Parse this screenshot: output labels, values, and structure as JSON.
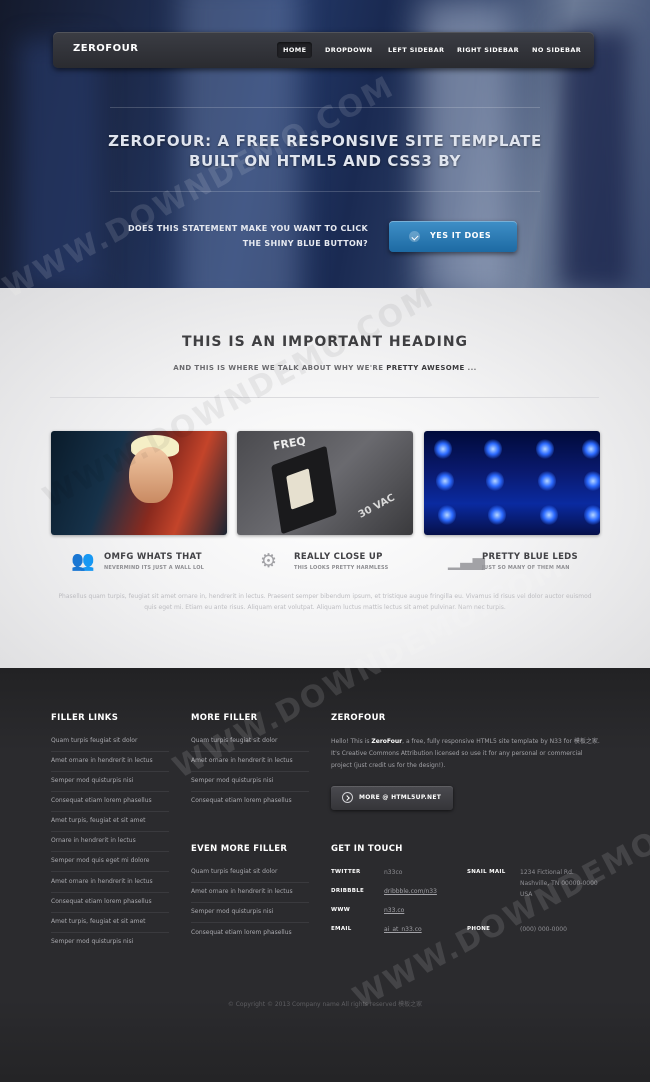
{
  "nav": {
    "logo": "ZEROFOUR",
    "items": [
      "HOME",
      "DROPDOWN",
      "LEFT SIDEBAR",
      "RIGHT SIDEBAR",
      "NO SIDEBAR"
    ]
  },
  "hero": {
    "title_line1": "ZEROFOUR: A FREE RESPONSIVE SITE TEMPLATE",
    "title_line2": "BUILT ON HTML5 AND CSS3 BY",
    "question_line1": "DOES THIS STATEMENT MAKE YOU WANT TO CLICK",
    "question_line2": "THE SHINY BLUE BUTTON?",
    "cta_label": "YES IT DOES"
  },
  "main": {
    "heading": "THIS IS AN IMPORTANT HEADING",
    "sub_prefix": "AND THIS IS WHERE WE TALK ABOUT WHY WE'RE",
    "sub_bold": "PRETTY AWESOME",
    "sub_suffix": "...",
    "thumb2_text1": "FREQ",
    "thumb2_text2": "30 VAC",
    "features": [
      {
        "icon": "users-icon",
        "title": "OMFG WHATS THAT",
        "subtitle": "NEVERMIND ITS JUST A WALL LOL"
      },
      {
        "icon": "gear-icon",
        "title": "REALLY CLOSE UP",
        "subtitle": "THIS LOOKS PRETTY HARMLESS"
      },
      {
        "icon": "bar-chart-icon",
        "title": "PRETTY BLUE LEDS",
        "subtitle": "JUST SO MANY OF THEM MAN"
      }
    ],
    "paragraph": "Phasellus quam turpis, feugiat sit amet ornare in, hendrerit in lectus. Praesent semper bibendum ipsum, et tristique augue fringilla eu. Vivamus id risus vel dolor auctor euismod quis eget mi. Etiam eu ante risus. Aliquam erat volutpat. Aliquam luctus mattis lectus sit amet pulvinar. Nam nec turpis."
  },
  "footer": {
    "filler_links": {
      "heading": "FILLER LINKS",
      "items": [
        "Quam turpis feugiat sit dolor",
        "Amet ornare in hendrerit in lectus",
        "Semper mod quisturpis nisi",
        "Consequat etiam lorem phasellus",
        "Amet turpis, feugiat et sit amet",
        "Ornare in hendrerit in lectus",
        "Semper mod quis eget mi dolore",
        "Amet ornare in hendrerit in lectus",
        "Consequat etiam lorem phasellus",
        "Amet turpis, feugiat et sit amet",
        "Semper mod quisturpis nisi"
      ]
    },
    "more_filler": {
      "heading": "MORE FILLER",
      "items": [
        "Quam turpis feugiat sit dolor",
        "Amet ornare in hendrerit in lectus",
        "Semper mod quisturpis nisi",
        "Consequat etiam lorem phasellus"
      ]
    },
    "even_more_filler": {
      "heading": "EVEN MORE FILLER",
      "items": [
        "Quam turpis feugiat sit dolor",
        "Amet ornare in hendrerit in lectus",
        "Semper mod quisturpis nisi",
        "Consequat etiam lorem phasellus"
      ]
    },
    "about": {
      "heading": "ZEROFOUR",
      "text_prefix": "Hello! This is",
      "text_bold": "ZeroFour",
      "text_rest": ", a free, fully responsive HTML5 site template by N33 for 模板之家. It's Creative Commons Attribution licensed so use it for any personal or commercial project (just credit us for the design!).",
      "button_label": "MORE @ HTML5UP.NET"
    },
    "contact": {
      "heading": "GET IN TOUCH",
      "twitter_label": "TWITTER",
      "twitter_value": "n33co",
      "dribbble_label": "DRIBBBLE",
      "dribbble_value": "dribbble.com/n33",
      "www_label": "WWW",
      "www_value": "n33.co",
      "email_label": "EMAIL",
      "email_value": "ai_at_n33.co",
      "snail_label": "SNAIL MAIL",
      "snail_line1": "1234 Fictional Rd.",
      "snail_line2": "Nashville, TN 00000-0000",
      "snail_line3": "USA",
      "phone_label": "PHONE",
      "phone_value": "(000) 000-0000"
    },
    "copyright": "© Copyright © 2013 Company name All rights reserved 模板之家"
  },
  "watermark": "WWW.DOWNDEMO.COM"
}
